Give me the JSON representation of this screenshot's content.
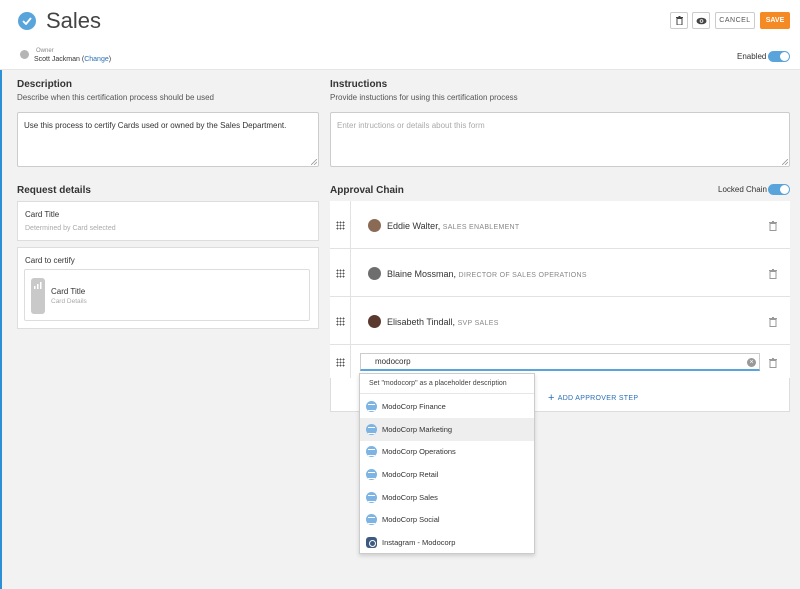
{
  "header": {
    "title": "Sales",
    "owner_caption": "Owner",
    "owner_name": "Scott Jackman",
    "owner_change": "Change",
    "cancel_label": "CANCEL",
    "save_label": "SAVE",
    "enabled_label": "Enabled",
    "enabled": true
  },
  "description": {
    "heading": "Description",
    "subtitle": "Describe when this certification process should be used",
    "value": "Use this process to certify Cards used or owned by the Sales Department."
  },
  "instructions": {
    "heading": "Instructions",
    "subtitle": "Provide instuctions for using this certification process",
    "placeholder": "Enter intructions or details about this form"
  },
  "request_details": {
    "heading": "Request details",
    "card_title_label": "Card Title",
    "card_title_placeholder": "Determined by Card selected",
    "card_to_certify_label": "Card to certify",
    "card_name": "Card Title",
    "card_details": "Card Details"
  },
  "approval_chain": {
    "heading": "Approval Chain",
    "locked_label": "Locked Chain",
    "locked": true,
    "approvers": [
      {
        "name": "Eddie Walter",
        "role": "SALES ENABLEMENT"
      },
      {
        "name": "Blaine Mossman",
        "role": "DIRECTOR OF SALES OPERATIONS"
      },
      {
        "name": "Elisabeth Tindall",
        "role": "SVP SALES"
      }
    ],
    "search_value": "modocorp",
    "add_step_label": "ADD APPROVER STEP"
  },
  "dropdown": {
    "header": "Set \"modocorp\" as a placeholder description",
    "items": [
      {
        "label": "ModoCorp Finance",
        "icon": "group-icon"
      },
      {
        "label": "ModoCorp Marketing",
        "icon": "group-icon",
        "highlighted": true
      },
      {
        "label": "ModoCorp Operations",
        "icon": "group-icon"
      },
      {
        "label": "ModoCorp Retail",
        "icon": "group-icon"
      },
      {
        "label": "ModoCorp Sales",
        "icon": "group-icon"
      },
      {
        "label": "ModoCorp Social",
        "icon": "group-icon"
      },
      {
        "label": "Instagram - Modocorp",
        "icon": "instagram-icon"
      }
    ]
  },
  "colors": {
    "accent": "#5aa4dc",
    "save": "#f58a24",
    "link": "#2a6fb7"
  }
}
